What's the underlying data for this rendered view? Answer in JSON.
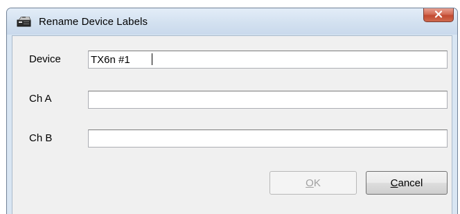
{
  "window": {
    "title": "Rename Device Labels"
  },
  "fields": [
    {
      "label": "Device",
      "value": "TX6n #1"
    },
    {
      "label": "Ch A",
      "value": ""
    },
    {
      "label": "Ch B",
      "value": ""
    }
  ],
  "buttons": {
    "ok": {
      "mnemonic": "O",
      "rest": "K",
      "enabled": false
    },
    "cancel": {
      "mnemonic": "C",
      "rest": "ancel",
      "enabled": true
    }
  },
  "icons": {
    "app": "device-app-icon",
    "close": "close-icon"
  },
  "colors": {
    "titlebar": "#d3e1f0",
    "client": "#f0f0f0",
    "close_button": "#c24a31"
  }
}
